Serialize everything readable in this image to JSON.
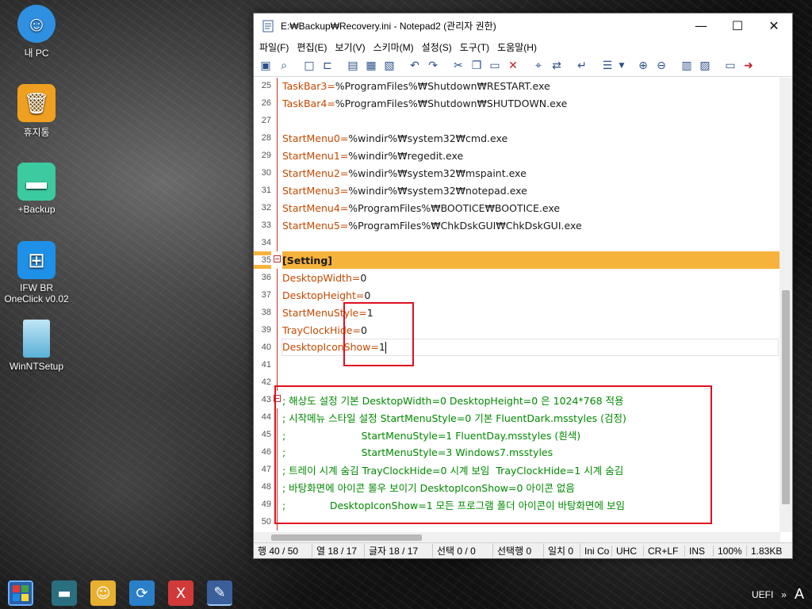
{
  "desktop": {
    "icons": [
      {
        "label": "내 PC",
        "icon": "my-pc-icon",
        "color": "#2f8fe0"
      },
      {
        "label": "휴지통",
        "icon": "recycle-bin-icon",
        "color": "#f0a020"
      },
      {
        "label": "+Backup",
        "icon": "folder-icon",
        "color": "#3ccaa0"
      },
      {
        "label": "IFW BR\nOneClick v0.02",
        "icon": "windows-logo-icon",
        "color": "#1e90e8"
      },
      {
        "label": "WinNTSetup",
        "icon": "winntsetup-icon",
        "color": "#5ab0d8"
      }
    ]
  },
  "window": {
    "title": "E:₩Backup₩Recovery.ini - Notepad2 (관리자 권한)",
    "controls": {
      "minimize": "—",
      "maximize": "☐",
      "close": "✕"
    },
    "menu": [
      "파일(F)",
      "편집(E)",
      "보기(V)",
      "스키마(M)",
      "설정(S)",
      "도구(T)",
      "도움말(H)"
    ],
    "toolbar": [
      "open-browse-icon",
      "find-file-icon",
      "new-file-icon",
      "open-folder-icon",
      "save-icon",
      "save-as-icon",
      "save-copy-icon",
      "undo-icon",
      "redo-icon",
      "cut-icon",
      "copy-icon",
      "paste-icon",
      "delete-icon",
      "find-icon",
      "replace-icon",
      "word-wrap-icon",
      "view-options-icon",
      "zoom-in-icon",
      "zoom-out-icon",
      "schema-icon",
      "customize-icon",
      "exit-icon"
    ]
  },
  "editor": {
    "lines": [
      {
        "num": "25",
        "key": "TaskBar3",
        "val": "%ProgramFiles%₩Shutdown₩RESTART.exe",
        "type": "kv"
      },
      {
        "num": "26",
        "key": "TaskBar4",
        "val": "%ProgramFiles%₩Shutdown₩SHUTDOWN.exe",
        "type": "kv"
      },
      {
        "num": "27",
        "key": "",
        "val": "",
        "type": "empty"
      },
      {
        "num": "28",
        "key": "StartMenu0",
        "val": "%windir%₩system32₩cmd.exe",
        "type": "kv"
      },
      {
        "num": "29",
        "key": "StartMenu1",
        "val": "%windir%₩regedit.exe",
        "type": "kv"
      },
      {
        "num": "30",
        "key": "StartMenu2",
        "val": "%windir%₩system32₩mspaint.exe",
        "type": "kv"
      },
      {
        "num": "31",
        "key": "StartMenu3",
        "val": "%windir%₩system32₩notepad.exe",
        "type": "kv"
      },
      {
        "num": "32",
        "key": "StartMenu4",
        "val": "%ProgramFiles%₩BOOTICE₩BOOTICE.exe",
        "type": "kv"
      },
      {
        "num": "33",
        "key": "StartMenu5",
        "val": "%ProgramFiles%₩ChkDskGUI₩ChkDskGUI.exe",
        "type": "kv"
      },
      {
        "num": "34",
        "key": "",
        "val": "",
        "type": "empty"
      },
      {
        "num": "35",
        "text": "[Setting]",
        "type": "section"
      },
      {
        "num": "36",
        "key": "DesktopWidth",
        "val": "0",
        "type": "kv"
      },
      {
        "num": "37",
        "key": "DesktopHeight",
        "val": "0",
        "type": "kv"
      },
      {
        "num": "38",
        "key": "StartMenuStyle",
        "val": "1",
        "type": "kv"
      },
      {
        "num": "39",
        "key": "TrayClockHide",
        "val": "0",
        "type": "kv"
      },
      {
        "num": "40",
        "key": "DesktopIconShow",
        "val": "1",
        "type": "kv",
        "current": true
      },
      {
        "num": "41",
        "key": "",
        "val": "",
        "type": "empty"
      },
      {
        "num": "42",
        "key": "",
        "val": "",
        "type": "empty"
      },
      {
        "num": "43",
        "text": "; 해상도 설정 기본 DesktopWidth=0 DesktopHeight=0 은 1024*768 적용",
        "type": "comment"
      },
      {
        "num": "44",
        "text": "; 시작메뉴 스타일 설정 StartMenuStyle=0 기본 FluentDark.msstyles (검정)",
        "type": "comment"
      },
      {
        "num": "45",
        "text": ";                        StartMenuStyle=1 FluentDay.msstyles (흰색)",
        "type": "comment"
      },
      {
        "num": "46",
        "text": ";                        StartMenuStyle=3 Windows7.msstyles",
        "type": "comment"
      },
      {
        "num": "47",
        "text": "; 트레이 시계 숨김 TrayClockHide=0 시계 보임  TrayClockHide=1 시계 숨김",
        "type": "comment"
      },
      {
        "num": "48",
        "text": "; 바탕화면에 아이콘 몰우 보이기 DesktopIconShow=0 아이콘 없음",
        "type": "comment"
      },
      {
        "num": "49",
        "text": ";              DesktopIconShow=1 모든 프로그램 폴더 아이콘이 바탕화면에 보임",
        "type": "comment"
      },
      {
        "num": "50",
        "key": "",
        "val": "",
        "type": "empty"
      }
    ]
  },
  "status": [
    "행 40 / 50",
    "열 18 / 17",
    "글자 18 / 17",
    "선택 0 / 0",
    "선택행 0",
    "일치 0",
    "Ini Co",
    "UHC",
    "CR+LF",
    "INS",
    "100%",
    "1.83KB"
  ],
  "taskbar": {
    "apps": [
      "start-icon",
      "window-icon",
      "user-icon",
      "sync-icon",
      "x-app-icon",
      "notepad-icon"
    ],
    "tray": {
      "label": "UEFI",
      "chevron": "»",
      "ime": "A"
    }
  },
  "colors": {
    "section_highlight": "#f6b33c",
    "key": "#c34a00",
    "comment": "#008a00",
    "annotation_box": "#e01020"
  }
}
